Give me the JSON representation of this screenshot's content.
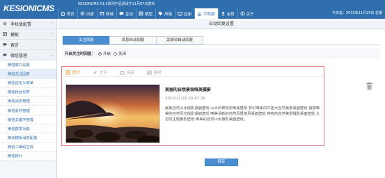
{
  "header": {
    "logo": "KESIONICMS",
    "notice": "KESIONCMS X1.5系列产品测试于11月07日发布",
    "date": "今天是：2015年11月25日 星期",
    "nav": [
      {
        "label": "首页",
        "icon": "home-icon",
        "active": false
      },
      {
        "label": "内容",
        "icon": "content-icon",
        "active": false
      },
      {
        "label": "商城",
        "icon": "shop-icon",
        "active": false
      },
      {
        "label": "互动",
        "icon": "chat-icon",
        "active": false
      },
      {
        "label": "模型",
        "icon": "model-icon",
        "active": false
      },
      {
        "label": "风格",
        "icon": "tag-icon",
        "active": false
      },
      {
        "label": "应用",
        "icon": "app-icon",
        "active": false
      },
      {
        "label": "手机版",
        "icon": "mobile-icon",
        "active": true
      },
      {
        "label": "会员",
        "icon": "user-icon",
        "active": false
      },
      {
        "label": "关于",
        "icon": "info-icon",
        "active": false
      }
    ]
  },
  "sidebar": {
    "groups": [
      {
        "label": "手机版配置",
        "icon": "gear-icon"
      },
      {
        "label": "模板",
        "icon": "template-icon"
      },
      {
        "label": "留言",
        "icon": "message-icon"
      },
      {
        "label": "微信管理",
        "icon": "wechat-icon"
      }
    ],
    "items": [
      {
        "label": "微信窗口设置",
        "active": false
      },
      {
        "label": "微信关注回复",
        "active": true
      },
      {
        "label": "微信自定义菜单",
        "active": false
      },
      {
        "label": "微信粉丝列表",
        "active": false
      },
      {
        "label": "微信消息管理",
        "active": false
      },
      {
        "label": "微信素材管理",
        "active": false
      },
      {
        "label": "微信关键字管理",
        "active": false
      },
      {
        "label": "微信群发功能",
        "active": false
      },
      {
        "label": "微信模板消息配置",
        "active": false
      },
      {
        "label": "微信二维码生成",
        "active": false
      },
      {
        "label": "微信统计",
        "active": false
      }
    ]
  },
  "page": {
    "title": "自动回复设置",
    "tabs": [
      {
        "label": "关注回复",
        "active": true
      },
      {
        "label": "消息自动回复",
        "active": false
      },
      {
        "label": "关键词自动回复",
        "active": false
      }
    ],
    "setting": {
      "label": "开启关注时回复：",
      "options": [
        {
          "label": "开启",
          "checked": true
        },
        {
          "label": "关闭",
          "checked": false
        }
      ]
    },
    "content_types": [
      {
        "label": "图文",
        "icon": "article-icon",
        "active": true
      },
      {
        "label": "文字",
        "icon": "pen-icon",
        "active": false
      },
      {
        "label": "商品",
        "icon": "product-icon",
        "active": false
      },
      {
        "label": "素材",
        "icon": "material-icon",
        "active": false
      }
    ],
    "article": {
      "title": "美丽的自然景观唯美摄影",
      "time": "2015/11/25 16:47:30",
      "body": "最美自然山水摄影桌面壁纸 山水风景荒原唯美壁纸 梦幻唯美的中国大自然美景桌面壁纸 震撼唯美的自然风光摄影桌面壁纸 唯美清新的自然风景荒原桌面壁纸 神奇的自然美景摄影桌面壁纸 大自然主题摄影壁纸 唯美的自然山水摄影桌面壁纸。"
    },
    "save_label": "保存"
  },
  "colors": {
    "brand": "#2f6fae",
    "accent": "#4a8ed0",
    "highlight_border": "#e37f7f",
    "active_type": "#e49b39"
  }
}
